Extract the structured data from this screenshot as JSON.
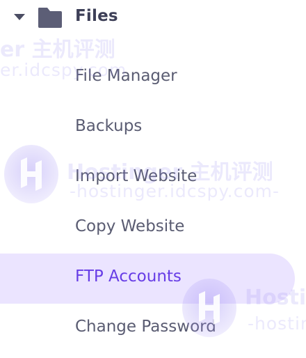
{
  "section": {
    "title": "Files",
    "caret_icon": "caret-down-icon",
    "folder_icon": "folder-icon"
  },
  "menu": {
    "items": [
      {
        "label": "File Manager",
        "active": false
      },
      {
        "label": "Backups",
        "active": false
      },
      {
        "label": "Import Website",
        "active": false
      },
      {
        "label": "Copy Website",
        "active": false
      },
      {
        "label": "FTP Accounts",
        "active": true
      },
      {
        "label": "Change Password",
        "active": false
      }
    ]
  },
  "watermark": {
    "line1": "Hostinger 主机评测",
    "line2": "-hostinger.idcspy.com-",
    "line1_partial_top": "er 主机评测",
    "line2_partial_top": "er.idcspy.com",
    "line1_partial_right": "Hosti",
    "line2_partial_right": "-hostin"
  },
  "colors": {
    "accent": "#673de6",
    "active_bg": "#ebe4ff",
    "text": "#5a5c72",
    "header_text": "#3d3f57"
  }
}
